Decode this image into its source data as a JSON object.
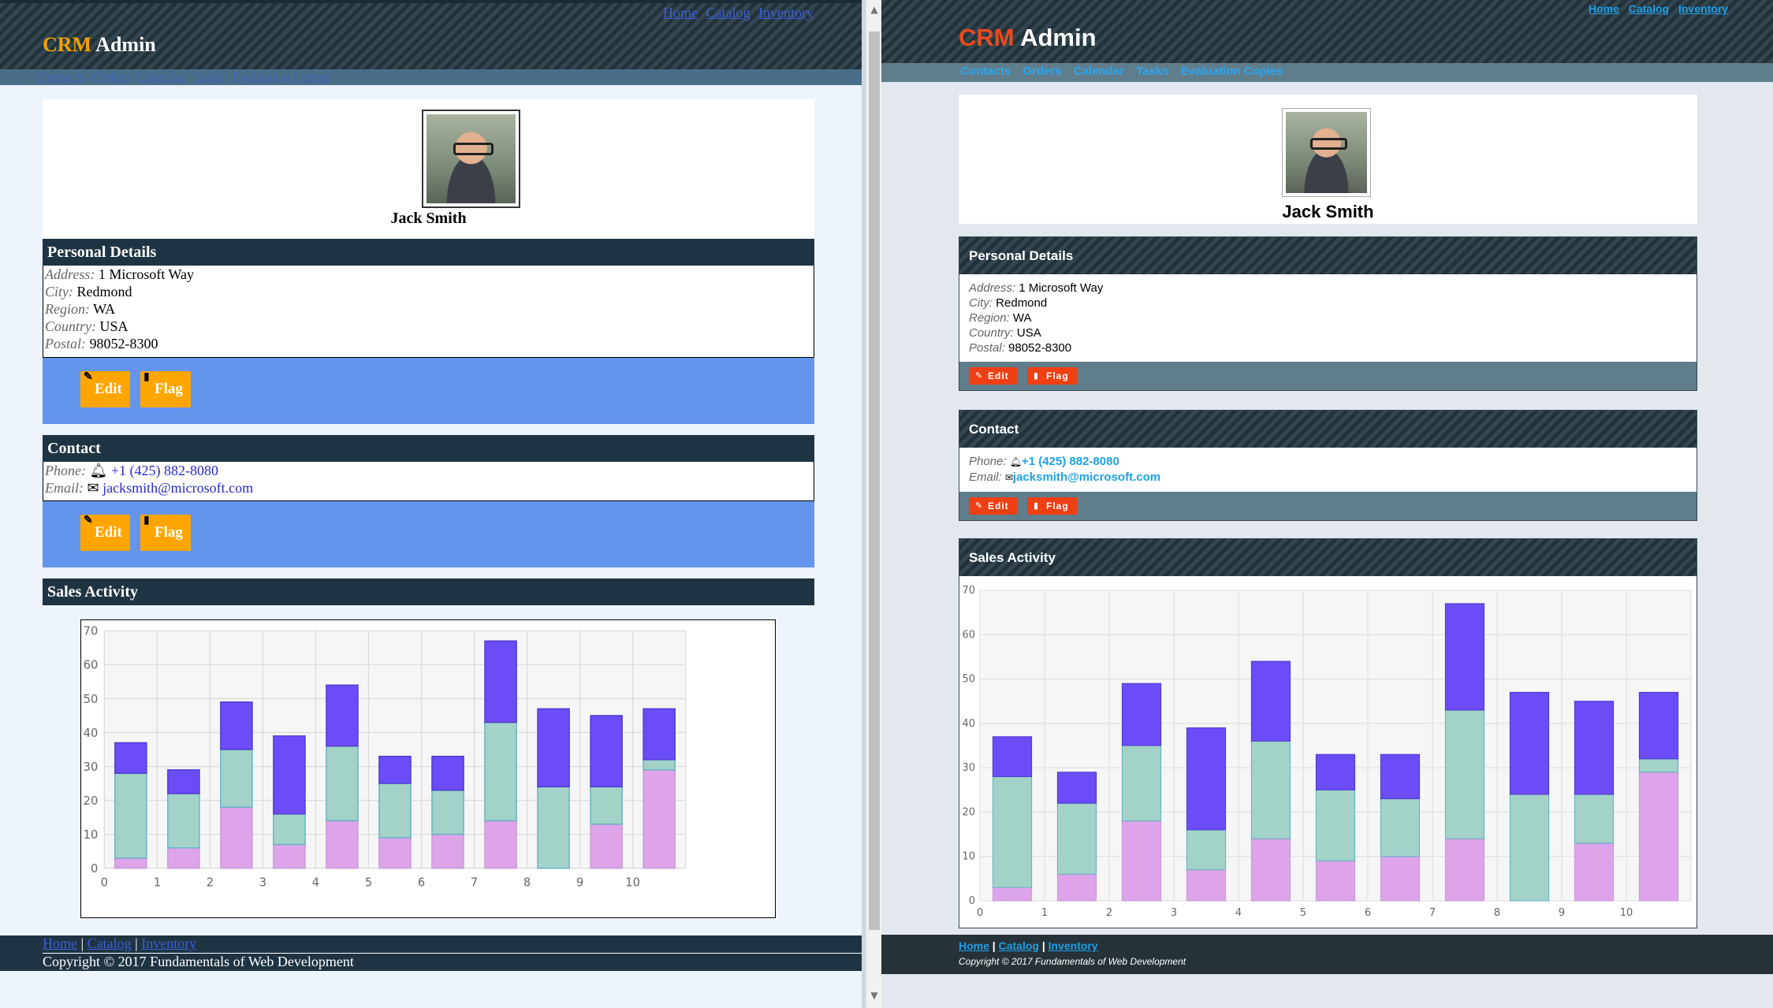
{
  "brand": {
    "crm": "CRM",
    "admin": "Admin"
  },
  "top_links": [
    "Home",
    "Catalog",
    "Inventory"
  ],
  "nav": [
    "Contacts",
    "Orders",
    "Calendar",
    "Tasks",
    "Evaluation Copies"
  ],
  "profile": {
    "name": "Jack Smith"
  },
  "personal": {
    "title": "Personal Details",
    "address_label": "Address:",
    "address": "1 Microsoft Way",
    "city_label": "City:",
    "city": "Redmond",
    "region_label": "Region:",
    "region": "WA",
    "country_label": "Country:",
    "country": "USA",
    "postal_label": "Postal:",
    "postal": "98052-8300"
  },
  "contact": {
    "title": "Contact",
    "phone_label": "Phone:",
    "phone": "+1 (425) 882-8080",
    "email_label": "Email:",
    "email": "jacksmith@microsoft.com"
  },
  "buttons": {
    "edit": "Edit",
    "flag": "Flag"
  },
  "sales": {
    "title": "Sales Activity"
  },
  "footer": {
    "links": [
      "Home",
      "Catalog",
      "Inventory"
    ],
    "separator": "|",
    "copyright": "Copyright © 2017 Fundamentals of Web Development"
  },
  "colors": {
    "series_bottom": "#dda4ea",
    "series_middle": "#a2d2c8",
    "series_top": "#6c4cf7",
    "left_accent": "#ffa500",
    "right_accent": "#ef3f14"
  },
  "chart_data": {
    "type": "bar",
    "stacked": true,
    "x": [
      0,
      1,
      2,
      3,
      4,
      5,
      6,
      7,
      8,
      9,
      10
    ],
    "ylim": [
      0,
      70
    ],
    "yticks": [
      0,
      10,
      20,
      30,
      40,
      50,
      60,
      70
    ],
    "grid": true,
    "series": [
      {
        "values": [
          3,
          6,
          18,
          7,
          14,
          9,
          10,
          14,
          0,
          13,
          29
        ]
      },
      {
        "values": [
          25,
          16,
          17,
          9,
          22,
          16,
          13,
          29,
          24,
          11,
          3
        ]
      },
      {
        "values": [
          9,
          7,
          14,
          23,
          18,
          8,
          10,
          24,
          23,
          21,
          15
        ]
      }
    ]
  }
}
